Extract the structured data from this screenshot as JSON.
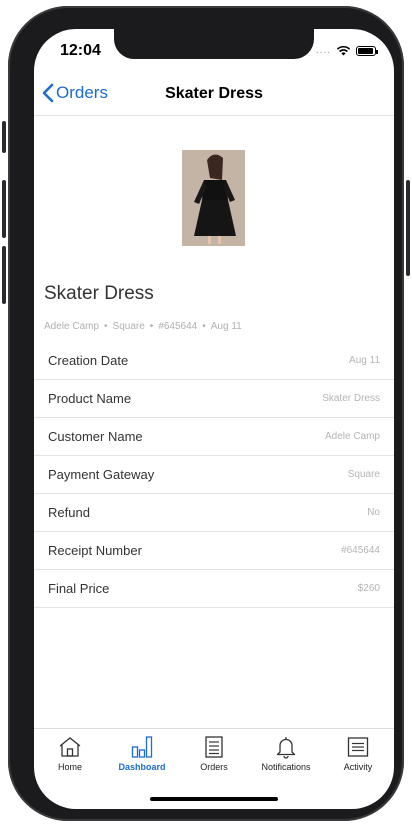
{
  "status_bar": {
    "time": "12:04",
    "signal_dots": "....",
    "wifi_icon": "wifi-icon",
    "battery_icon": "battery-icon"
  },
  "navbar": {
    "back_label": "Orders",
    "title": "Skater Dress",
    "accent": "#1c6dd0"
  },
  "product": {
    "image_icon": "product-photo",
    "title": "Skater Dress",
    "meta": [
      "Adele Camp",
      "Square",
      "#645644",
      "Aug 11"
    ],
    "separator": "•"
  },
  "details": [
    {
      "label": "Creation Date",
      "value": "Aug 11"
    },
    {
      "label": "Product Name",
      "value": "Skater Dress"
    },
    {
      "label": "Customer Name",
      "value": "Adele Camp"
    },
    {
      "label": "Payment Gateway",
      "value": "Square"
    },
    {
      "label": "Refund",
      "value": "No"
    },
    {
      "label": "Receipt Number",
      "value": "#645644"
    },
    {
      "label": "Final Price",
      "value": "$260"
    }
  ],
  "tabs": [
    {
      "label": "Home",
      "icon": "home-icon",
      "active": false
    },
    {
      "label": "Dashboard",
      "icon": "bar-chart-icon",
      "active": true
    },
    {
      "label": "Orders",
      "icon": "list-document-icon",
      "active": false
    },
    {
      "label": "Notifications",
      "icon": "bell-icon",
      "active": false
    },
    {
      "label": "Activity",
      "icon": "activity-list-icon",
      "active": false
    }
  ]
}
